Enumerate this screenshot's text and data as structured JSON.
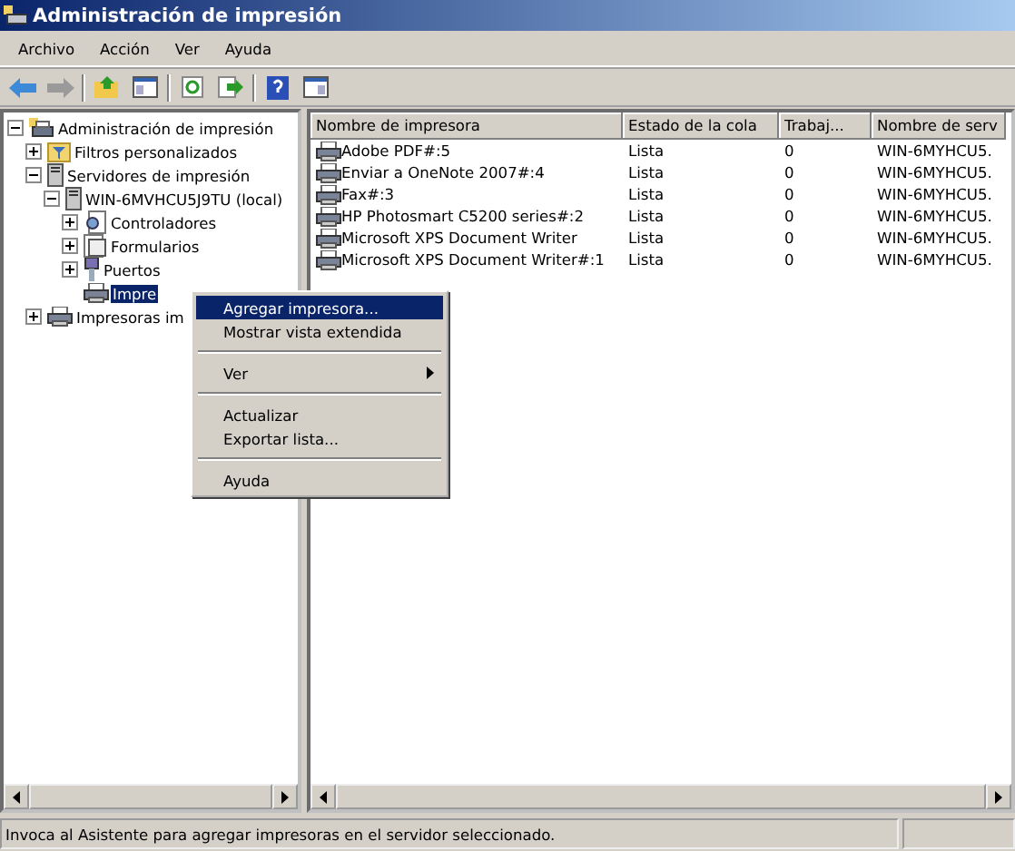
{
  "window": {
    "title": "Administración de impresión"
  },
  "menu_bar": [
    "Archivo",
    "Acción",
    "Ver",
    "Ayuda"
  ],
  "tree": [
    {
      "label": "Administración de impresión",
      "kind": "root",
      "expanded": true,
      "selected": false,
      "children": [
        {
          "label": "Filtros personalizados",
          "kind": "filter",
          "expanded": false,
          "selected": false
        },
        {
          "label": "Servidores de impresión",
          "kind": "server",
          "expanded": true,
          "selected": false,
          "children": [
            {
              "label": "WIN-6MVHCU5J9TU (local)",
              "kind": "server",
              "expanded": true,
              "selected": false,
              "children": [
                {
                  "label": "Controladores",
                  "kind": "driver",
                  "expanded": false,
                  "selected": false
                },
                {
                  "label": "Formularios",
                  "kind": "form",
                  "expanded": false,
                  "selected": false
                },
                {
                  "label": "Puertos",
                  "kind": "port",
                  "expanded": false,
                  "selected": false
                },
                {
                  "label": "Impre",
                  "kind": "printer",
                  "selected": true
                }
              ]
            }
          ]
        },
        {
          "label": "Impresoras im",
          "kind": "printer",
          "expanded": false,
          "selected": false
        }
      ]
    }
  ],
  "table": {
    "columns": [
      "Nombre de impresora",
      "Estado de la cola",
      "Trabaj...",
      "Nombre de serv"
    ],
    "rows": [
      [
        "Adobe PDF#:5",
        "Lista",
        "0",
        "WIN-6MYHCU5."
      ],
      [
        "Enviar a OneNote 2007#:4",
        "Lista",
        "0",
        "WIN-6MYHCU5."
      ],
      [
        "Fax#:3",
        "Lista",
        "0",
        "WIN-6MYHCU5."
      ],
      [
        "HP Photosmart C5200 series#:2",
        "Lista",
        "0",
        "WIN-6MYHCU5."
      ],
      [
        "Microsoft XPS Document Writer",
        "Lista",
        "0",
        "WIN-6MYHCU5."
      ],
      [
        "Microsoft XPS Document Writer#:1",
        "Lista",
        "0",
        "WIN-6MYHCU5."
      ]
    ]
  },
  "context_menu": [
    {
      "kind": "item",
      "label": "Agregar impresora...",
      "selected": true
    },
    {
      "kind": "item",
      "label": "Mostrar vista extendida",
      "selected": false
    },
    {
      "kind": "separator"
    },
    {
      "kind": "submenu",
      "label": "Ver",
      "selected": false
    },
    {
      "kind": "separator"
    },
    {
      "kind": "item",
      "label": "Actualizar",
      "selected": false
    },
    {
      "kind": "item",
      "label": "Exportar lista...",
      "selected": false
    },
    {
      "kind": "separator"
    },
    {
      "kind": "item",
      "label": "Ayuda",
      "selected": false
    }
  ],
  "status_bar": "Invoca al Asistente para agregar impresoras en el servidor seleccionado."
}
